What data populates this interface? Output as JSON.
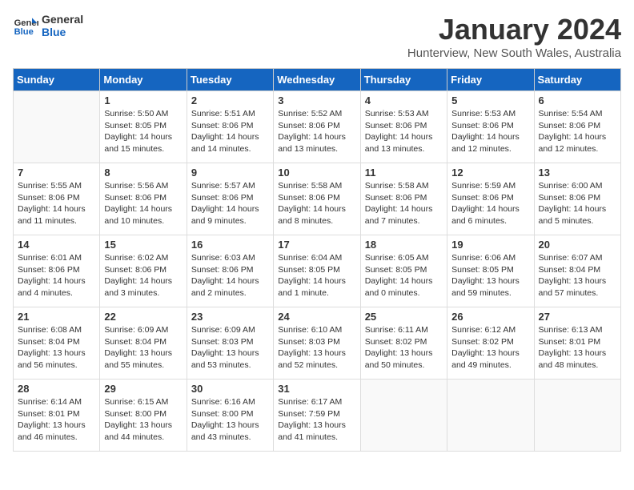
{
  "header": {
    "logo_line1": "General",
    "logo_line2": "Blue",
    "title": "January 2024",
    "subtitle": "Hunterview, New South Wales, Australia"
  },
  "weekdays": [
    "Sunday",
    "Monday",
    "Tuesday",
    "Wednesday",
    "Thursday",
    "Friday",
    "Saturday"
  ],
  "weeks": [
    [
      {
        "num": "",
        "info": ""
      },
      {
        "num": "1",
        "info": "Sunrise: 5:50 AM\nSunset: 8:05 PM\nDaylight: 14 hours\nand 15 minutes."
      },
      {
        "num": "2",
        "info": "Sunrise: 5:51 AM\nSunset: 8:06 PM\nDaylight: 14 hours\nand 14 minutes."
      },
      {
        "num": "3",
        "info": "Sunrise: 5:52 AM\nSunset: 8:06 PM\nDaylight: 14 hours\nand 13 minutes."
      },
      {
        "num": "4",
        "info": "Sunrise: 5:53 AM\nSunset: 8:06 PM\nDaylight: 14 hours\nand 13 minutes."
      },
      {
        "num": "5",
        "info": "Sunrise: 5:53 AM\nSunset: 8:06 PM\nDaylight: 14 hours\nand 12 minutes."
      },
      {
        "num": "6",
        "info": "Sunrise: 5:54 AM\nSunset: 8:06 PM\nDaylight: 14 hours\nand 12 minutes."
      }
    ],
    [
      {
        "num": "7",
        "info": "Sunrise: 5:55 AM\nSunset: 8:06 PM\nDaylight: 14 hours\nand 11 minutes."
      },
      {
        "num": "8",
        "info": "Sunrise: 5:56 AM\nSunset: 8:06 PM\nDaylight: 14 hours\nand 10 minutes."
      },
      {
        "num": "9",
        "info": "Sunrise: 5:57 AM\nSunset: 8:06 PM\nDaylight: 14 hours\nand 9 minutes."
      },
      {
        "num": "10",
        "info": "Sunrise: 5:58 AM\nSunset: 8:06 PM\nDaylight: 14 hours\nand 8 minutes."
      },
      {
        "num": "11",
        "info": "Sunrise: 5:58 AM\nSunset: 8:06 PM\nDaylight: 14 hours\nand 7 minutes."
      },
      {
        "num": "12",
        "info": "Sunrise: 5:59 AM\nSunset: 8:06 PM\nDaylight: 14 hours\nand 6 minutes."
      },
      {
        "num": "13",
        "info": "Sunrise: 6:00 AM\nSunset: 8:06 PM\nDaylight: 14 hours\nand 5 minutes."
      }
    ],
    [
      {
        "num": "14",
        "info": "Sunrise: 6:01 AM\nSunset: 8:06 PM\nDaylight: 14 hours\nand 4 minutes."
      },
      {
        "num": "15",
        "info": "Sunrise: 6:02 AM\nSunset: 8:06 PM\nDaylight: 14 hours\nand 3 minutes."
      },
      {
        "num": "16",
        "info": "Sunrise: 6:03 AM\nSunset: 8:06 PM\nDaylight: 14 hours\nand 2 minutes."
      },
      {
        "num": "17",
        "info": "Sunrise: 6:04 AM\nSunset: 8:05 PM\nDaylight: 14 hours\nand 1 minute."
      },
      {
        "num": "18",
        "info": "Sunrise: 6:05 AM\nSunset: 8:05 PM\nDaylight: 14 hours\nand 0 minutes."
      },
      {
        "num": "19",
        "info": "Sunrise: 6:06 AM\nSunset: 8:05 PM\nDaylight: 13 hours\nand 59 minutes."
      },
      {
        "num": "20",
        "info": "Sunrise: 6:07 AM\nSunset: 8:04 PM\nDaylight: 13 hours\nand 57 minutes."
      }
    ],
    [
      {
        "num": "21",
        "info": "Sunrise: 6:08 AM\nSunset: 8:04 PM\nDaylight: 13 hours\nand 56 minutes."
      },
      {
        "num": "22",
        "info": "Sunrise: 6:09 AM\nSunset: 8:04 PM\nDaylight: 13 hours\nand 55 minutes."
      },
      {
        "num": "23",
        "info": "Sunrise: 6:09 AM\nSunset: 8:03 PM\nDaylight: 13 hours\nand 53 minutes."
      },
      {
        "num": "24",
        "info": "Sunrise: 6:10 AM\nSunset: 8:03 PM\nDaylight: 13 hours\nand 52 minutes."
      },
      {
        "num": "25",
        "info": "Sunrise: 6:11 AM\nSunset: 8:02 PM\nDaylight: 13 hours\nand 50 minutes."
      },
      {
        "num": "26",
        "info": "Sunrise: 6:12 AM\nSunset: 8:02 PM\nDaylight: 13 hours\nand 49 minutes."
      },
      {
        "num": "27",
        "info": "Sunrise: 6:13 AM\nSunset: 8:01 PM\nDaylight: 13 hours\nand 48 minutes."
      }
    ],
    [
      {
        "num": "28",
        "info": "Sunrise: 6:14 AM\nSunset: 8:01 PM\nDaylight: 13 hours\nand 46 minutes."
      },
      {
        "num": "29",
        "info": "Sunrise: 6:15 AM\nSunset: 8:00 PM\nDaylight: 13 hours\nand 44 minutes."
      },
      {
        "num": "30",
        "info": "Sunrise: 6:16 AM\nSunset: 8:00 PM\nDaylight: 13 hours\nand 43 minutes."
      },
      {
        "num": "31",
        "info": "Sunrise: 6:17 AM\nSunset: 7:59 PM\nDaylight: 13 hours\nand 41 minutes."
      },
      {
        "num": "",
        "info": ""
      },
      {
        "num": "",
        "info": ""
      },
      {
        "num": "",
        "info": ""
      }
    ]
  ]
}
